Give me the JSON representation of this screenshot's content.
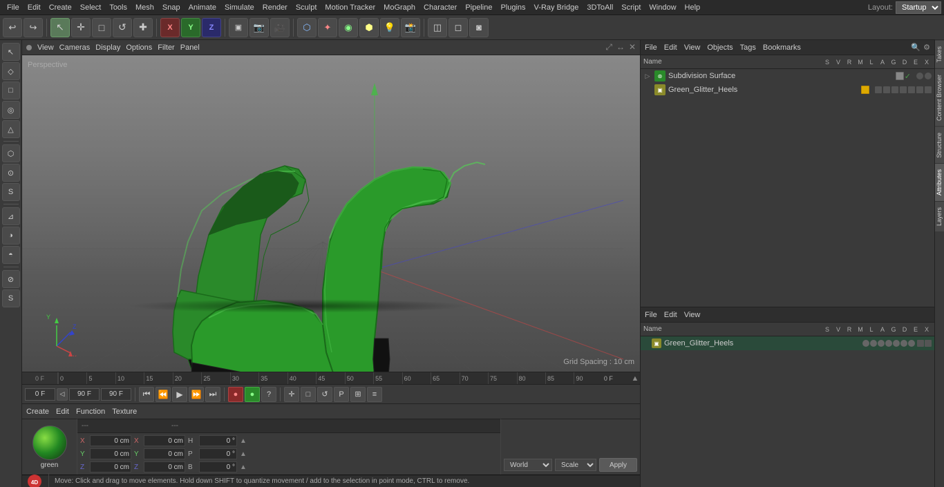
{
  "app": {
    "title": "Cinema 4D",
    "layout": "Startup"
  },
  "top_menu": {
    "items": [
      "File",
      "Edit",
      "Create",
      "Select",
      "Tools",
      "Mesh",
      "Snap",
      "Animate",
      "Simulate",
      "Render",
      "Sculpt",
      "Motion Tracker",
      "MoGraph",
      "Character",
      "Pipeline",
      "Plugins",
      "V-Ray Bridge",
      "3DToAll",
      "Script",
      "Window",
      "Help"
    ]
  },
  "toolbar": {
    "undo": "↩",
    "redo": "↪",
    "tools": [
      "↖",
      "✛",
      "□",
      "↺",
      "✚"
    ],
    "axes": [
      "X",
      "Y",
      "Z"
    ],
    "view_tools": [
      "▣",
      "▷",
      "⬡",
      "✦",
      "◉",
      "⬢",
      "◫",
      "◻",
      "◙",
      "◑",
      "💡"
    ]
  },
  "viewport": {
    "perspective": "Perspective",
    "grid_spacing": "Grid Spacing : 10 cm",
    "view_menus": [
      "View",
      "Cameras",
      "Display",
      "Options",
      "Filter",
      "Panel"
    ]
  },
  "left_tools": {
    "tools": [
      "↖",
      "◇",
      "□",
      "◎",
      "△",
      "⬡",
      "⊙",
      "S",
      "⊿",
      "◑",
      "◓",
      "⊘",
      "S"
    ]
  },
  "timeline": {
    "start_frame": "0 F",
    "end_frame_input": "90 F",
    "fps_input": "90 F",
    "numbers": [
      "0",
      "5",
      "10",
      "15",
      "20",
      "25",
      "30",
      "35",
      "40",
      "45",
      "50",
      "55",
      "60",
      "65",
      "70",
      "75",
      "80",
      "85",
      "90"
    ],
    "frame_input": "0 F",
    "frame_display": "0 F"
  },
  "transport": {
    "frame_start": "0 F",
    "frame_end": "90 F",
    "frame_min": "90 F",
    "frame_max": "90 F",
    "controls": [
      "⏮",
      "⏪",
      "▶",
      "⏩",
      "⏭",
      "⏺"
    ]
  },
  "object_manager": {
    "menus": [
      "File",
      "Edit",
      "View",
      "Objects",
      "Tags",
      "Bookmarks"
    ],
    "search_icon": "🔍",
    "columns": {
      "name": "Name",
      "cols": [
        "S",
        "V",
        "R",
        "M",
        "L",
        "A",
        "G",
        "D",
        "E",
        "X"
      ]
    },
    "objects": [
      {
        "name": "Subdivision Surface",
        "type": "subdivision",
        "icon": "green",
        "indent": 0,
        "checked": true,
        "has_check": true
      },
      {
        "name": "Green_Glitter_Heels",
        "type": "mesh",
        "icon": "yellow",
        "indent": 1,
        "checked": false,
        "has_check": false
      }
    ]
  },
  "attr_manager": {
    "menus": [
      "File",
      "Edit",
      "View"
    ],
    "columns": {
      "name": "Name",
      "cols": [
        "S",
        "V",
        "R",
        "M",
        "L",
        "A",
        "G",
        "D",
        "E",
        "X"
      ]
    },
    "items": [
      {
        "name": "Green_Glitter_Heels",
        "icon": "yellow"
      }
    ]
  },
  "material_panel": {
    "menus": [
      "Create",
      "Edit",
      "Function",
      "Texture"
    ],
    "material": {
      "name": "green",
      "color": "radial-gradient(circle at 35% 35%, #88dd44, #228822, #113311)"
    }
  },
  "coordinates": {
    "rows": [
      {
        "label": "X",
        "pos": "0 cm",
        "size": "0 cm",
        "h": "0 °"
      },
      {
        "label": "Y",
        "pos": "0 cm",
        "size": "0 cm",
        "p": "0 °"
      },
      {
        "label": "Z",
        "pos": "0 cm",
        "size": "0 cm",
        "b": "0 °"
      }
    ],
    "world_label": "World",
    "scale_label": "Scale",
    "apply_label": "Apply"
  },
  "status_bar": {
    "message": "Move: Click and drag to move elements. Hold down SHIFT to quantize movement / add to the selection in point mode, CTRL to remove."
  },
  "right_tabs": [
    "Takes",
    "Content Browser",
    "Structure",
    "Attributes",
    "Layers"
  ],
  "icons": {
    "undo": "↩",
    "redo": "↪",
    "move": "✛",
    "scale": "⊡",
    "rotate": "↺",
    "select": "↖",
    "play": "▶",
    "stop": "⏹",
    "record": "⏺",
    "settings": "⚙"
  }
}
